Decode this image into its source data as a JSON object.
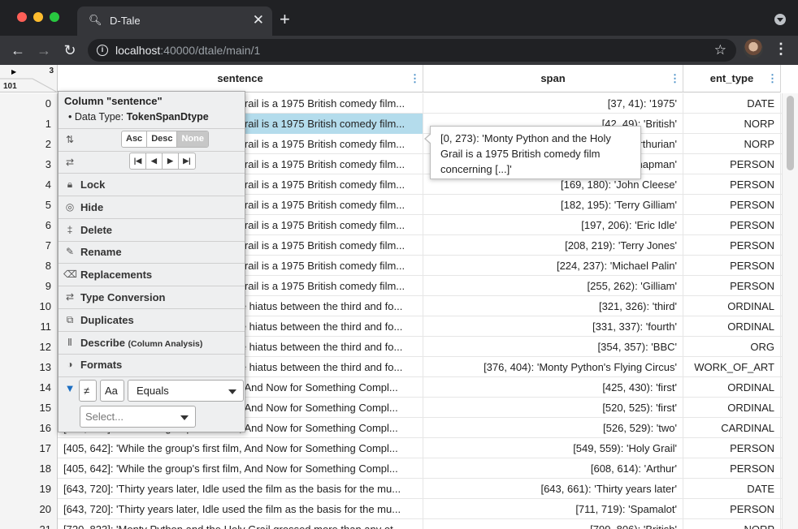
{
  "browser": {
    "tab_title": "D-Tale",
    "url_host": "localhost",
    "url_rest": ":40000/dtale/main/1"
  },
  "grid": {
    "corner": {
      "col_count": "3",
      "row_count": "101"
    },
    "columns": [
      "sentence",
      "span",
      "ent_type"
    ],
    "rows": [
      {
        "idx": "0",
        "sentence": "[0, 273]: 'Monty Python and the Holy Grail is a 1975 British comedy film...",
        "span": "[37, 41): '1975'",
        "ent": "DATE"
      },
      {
        "idx": "1",
        "sentence": "[0, 273]: 'Monty Python and the Holy Grail is a 1975 British comedy film...",
        "span": "[42, 49): 'British'",
        "ent": "NORP"
      },
      {
        "idx": "2",
        "sentence": "[0, 273]: 'Monty Python and the Holy Grail is a 1975 British comedy film...",
        "span": "[..., ...): 'Arthurian'",
        "ent": "NORP"
      },
      {
        "idx": "3",
        "sentence": "[0, 273]: 'Monty Python and the Holy Grail is a 1975 British comedy film...",
        "span": "[..., ...): 'Graham Chapman'",
        "ent": "PERSON"
      },
      {
        "idx": "4",
        "sentence": "[0, 273]: 'Monty Python and the Holy Grail is a 1975 British comedy film...",
        "span": "[169, 180): 'John Cleese'",
        "ent": "PERSON"
      },
      {
        "idx": "5",
        "sentence": "[0, 273]: 'Monty Python and the Holy Grail is a 1975 British comedy film...",
        "span": "[182, 195): 'Terry Gilliam'",
        "ent": "PERSON"
      },
      {
        "idx": "6",
        "sentence": "[0, 273]: 'Monty Python and the Holy Grail is a 1975 British comedy film...",
        "span": "[197, 206): 'Eric Idle'",
        "ent": "PERSON"
      },
      {
        "idx": "7",
        "sentence": "[0, 273]: 'Monty Python and the Holy Grail is a 1975 British comedy film...",
        "span": "[208, 219): 'Terry Jones'",
        "ent": "PERSON"
      },
      {
        "idx": "8",
        "sentence": "[0, 273]: 'Monty Python and the Holy Grail is a 1975 British comedy film...",
        "span": "[224, 237): 'Michael Palin'",
        "ent": "PERSON"
      },
      {
        "idx": "9",
        "sentence": "[0, 273]: 'Monty Python and the Holy Grail is a 1975 British comedy film...",
        "span": "[255, 262): 'Gilliam'",
        "ent": "PERSON"
      },
      {
        "idx": "10",
        "sentence": "[274, 404]: 'It was conceived during the hiatus between the third and fo...",
        "span": "[321, 326): 'third'",
        "ent": "ORDINAL"
      },
      {
        "idx": "11",
        "sentence": "[274, 404]: 'It was conceived during the hiatus between the third and fo...",
        "span": "[331, 337): 'fourth'",
        "ent": "ORDINAL"
      },
      {
        "idx": "12",
        "sentence": "[274, 404]: 'It was conceived during the hiatus between the third and fo...",
        "span": "[354, 357): 'BBC'",
        "ent": "ORG"
      },
      {
        "idx": "13",
        "sentence": "[274, 404]: 'It was conceived during the hiatus between the third and fo...",
        "span": "[376, 404): 'Monty Python's Flying Circus'",
        "ent": "WORK_OF_ART"
      },
      {
        "idx": "14",
        "sentence": "[405, 642]: 'While the group's first film, And Now for Something Compl...",
        "span": "[425, 430): 'first'",
        "ent": "ORDINAL"
      },
      {
        "idx": "15",
        "sentence": "[405, 642]: 'While the group's first film, And Now for Something Compl...",
        "span": "[520, 525): 'first'",
        "ent": "ORDINAL"
      },
      {
        "idx": "16",
        "sentence": "[405, 642]: 'While the group's first film, And Now for Something Compl...",
        "span": "[526, 529): 'two'",
        "ent": "CARDINAL"
      },
      {
        "idx": "17",
        "sentence": "[405, 642]: 'While the group's first film, And Now for Something Compl...",
        "span": "[549, 559): 'Holy Grail'",
        "ent": "PERSON"
      },
      {
        "idx": "18",
        "sentence": "[405, 642]: 'While the group's first film, And Now for Something Compl...",
        "span": "[608, 614): 'Arthur'",
        "ent": "PERSON"
      },
      {
        "idx": "19",
        "sentence": "[643, 720]: 'Thirty years later, Idle used the film as the basis for the mu...",
        "span": "[643, 661): 'Thirty years later'",
        "ent": "DATE"
      },
      {
        "idx": "20",
        "sentence": "[643, 720]: 'Thirty years later, Idle used the film as the basis for the mu...",
        "span": "[711, 719): 'Spamalot'",
        "ent": "PERSON"
      },
      {
        "idx": "21",
        "sentence": "[720, 823]: 'Monty Python and the Holy Grail grossed more than any ot...",
        "span": "[799, 806): 'British'",
        "ent": "NORP"
      }
    ],
    "selected_row": 1
  },
  "tooltip": {
    "text": "[0, 273): 'Monty Python and the Holy Grail is a 1975 British comedy film concerning [...]'"
  },
  "column_menu": {
    "title": "Column \"sentence\"",
    "dtype_label": "Data Type:",
    "dtype_value": "TokenSpanDtype",
    "sort": {
      "asc": "Asc",
      "desc": "Desc",
      "none": "None"
    },
    "items": [
      {
        "label": "Lock",
        "icon": "lock-icon"
      },
      {
        "label": "Hide",
        "icon": "eye-slash-icon"
      },
      {
        "label": "Delete",
        "icon": "trash-icon"
      },
      {
        "label": "Rename",
        "icon": "pencil-icon"
      },
      {
        "label": "Replacements",
        "icon": "backspace-icon"
      },
      {
        "label": "Type Conversion",
        "icon": "exchange-icon"
      },
      {
        "label": "Duplicates",
        "icon": "clone-icon"
      },
      {
        "label": "Describe",
        "sub": "(Column Analysis)",
        "icon": "columns-icon"
      },
      {
        "label": "Formats",
        "icon": "palette-icon"
      }
    ],
    "filter": {
      "not_label": "≠",
      "case_label": "Aa",
      "operator": "Equals",
      "select_placeholder": "Select..."
    }
  },
  "colors": {
    "selected_cell": "#b4dcec",
    "header_menu": "#4a90c8",
    "filter_icon": "#1b6ec2"
  }
}
